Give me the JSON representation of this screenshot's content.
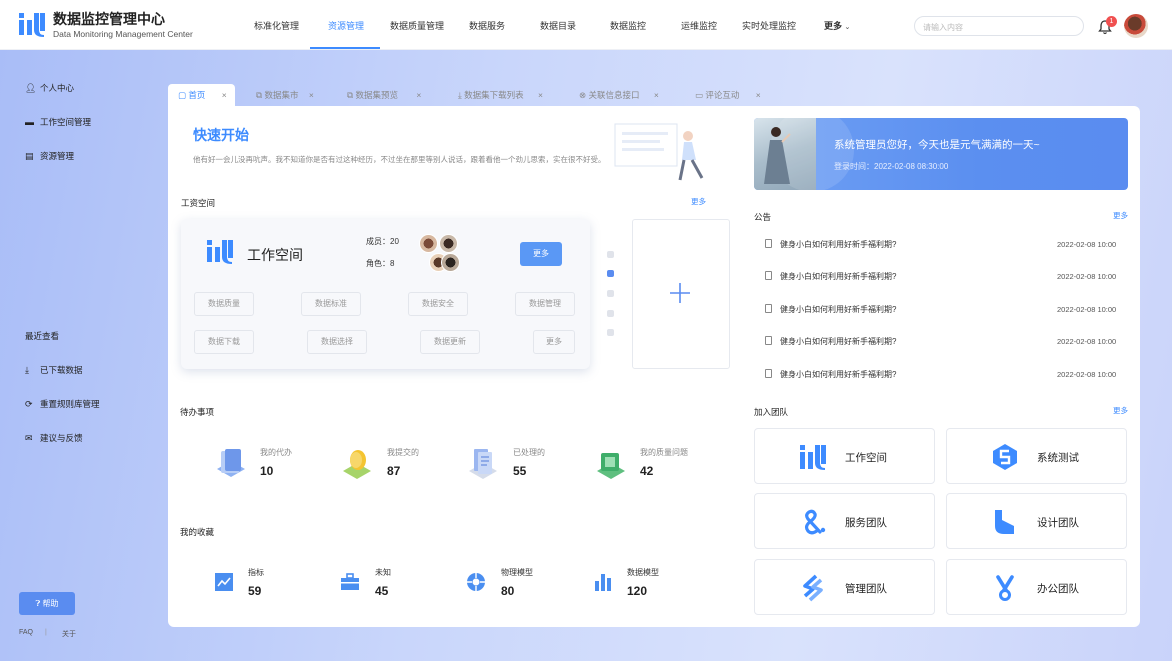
{
  "app": {
    "title_cn": "数据监控管理中心",
    "title_en": "Data Monitoring Management Center"
  },
  "nav": [
    "标准化管理",
    "资源管理",
    "数据质量管理",
    "数据服务",
    "数据目录",
    "数据监控",
    "运维监控",
    "实时处理监控",
    "更多"
  ],
  "nav_active": "资源管理",
  "search": {
    "placeholder": "请输入内容"
  },
  "notifications": {
    "count": "1"
  },
  "sidebar": {
    "items": [
      "个人中心",
      "工作空间管理",
      "资源管理"
    ],
    "recent_title": "最近查看",
    "recent": [
      "已下载数据",
      "重置规则库管理",
      "建议与反馈"
    ],
    "help": "帮助",
    "faq": "FAQ",
    "sep": "|",
    "about": "关于"
  },
  "tabs": [
    "首页",
    "数据集市",
    "数据集预览",
    "数据集下载列表",
    "关联信息接口",
    "评论互动"
  ],
  "quick_start": {
    "title": "快速开始",
    "subtitle": "他有好一会儿没再吭声。我不知道你是否有过这种经历，不过坐在那里等别人说话，跟着看他一个劲儿思索，实在很不好受。"
  },
  "workspace": {
    "section": "工资空间",
    "more": "更多",
    "name": "工作空间",
    "members_label": "成员：",
    "members": "20",
    "roles_label": "角色：",
    "roles": "8",
    "more_btn": "更多",
    "chips_row1": [
      "数据质量",
      "数据标准",
      "数据安全",
      "数据管理"
    ],
    "chips_row2": [
      "数据下载",
      "数据选择",
      "数据更新",
      "更多"
    ]
  },
  "todo": {
    "section": "待办事项",
    "items": [
      {
        "label": "我的代办",
        "value": "10"
      },
      {
        "label": "我提交的",
        "value": "87"
      },
      {
        "label": "已处理的",
        "value": "55"
      },
      {
        "label": "我的质量问题",
        "value": "42"
      }
    ]
  },
  "favorites": {
    "section": "我的收藏",
    "items": [
      {
        "label": "指标",
        "value": "59"
      },
      {
        "label": "未知",
        "value": "45"
      },
      {
        "label": "物理模型",
        "value": "80"
      },
      {
        "label": "数据模型",
        "value": "120"
      }
    ]
  },
  "banner": {
    "greeting": "系统管理员您好，今天也是元气满满的一天~",
    "login": "登录时间：2022-02-08 08:30:00"
  },
  "notices": {
    "section": "公告",
    "more": "更多",
    "items": [
      {
        "text": "健身小白如何利用好新手福利期?",
        "date": "2022-02-08 10:00"
      },
      {
        "text": "健身小白如何利用好新手福利期?",
        "date": "2022-02-08 10:00"
      },
      {
        "text": "健身小白如何利用好新手福利期?",
        "date": "2022-02-08 10:00"
      },
      {
        "text": "健身小白如何利用好新手福利期?",
        "date": "2022-02-08 10:00"
      },
      {
        "text": "健身小白如何利用好新手福利期?",
        "date": "2022-02-08 10:00"
      }
    ]
  },
  "teams": {
    "section": "加入团队",
    "more": "更多",
    "items": [
      "工作空间",
      "系统测试",
      "服务团队",
      "设计团队",
      "管理团队",
      "办公团队"
    ]
  },
  "colors": {
    "accent": "#3d8bff",
    "button": "#5a98f5",
    "badge": "#f05050"
  }
}
